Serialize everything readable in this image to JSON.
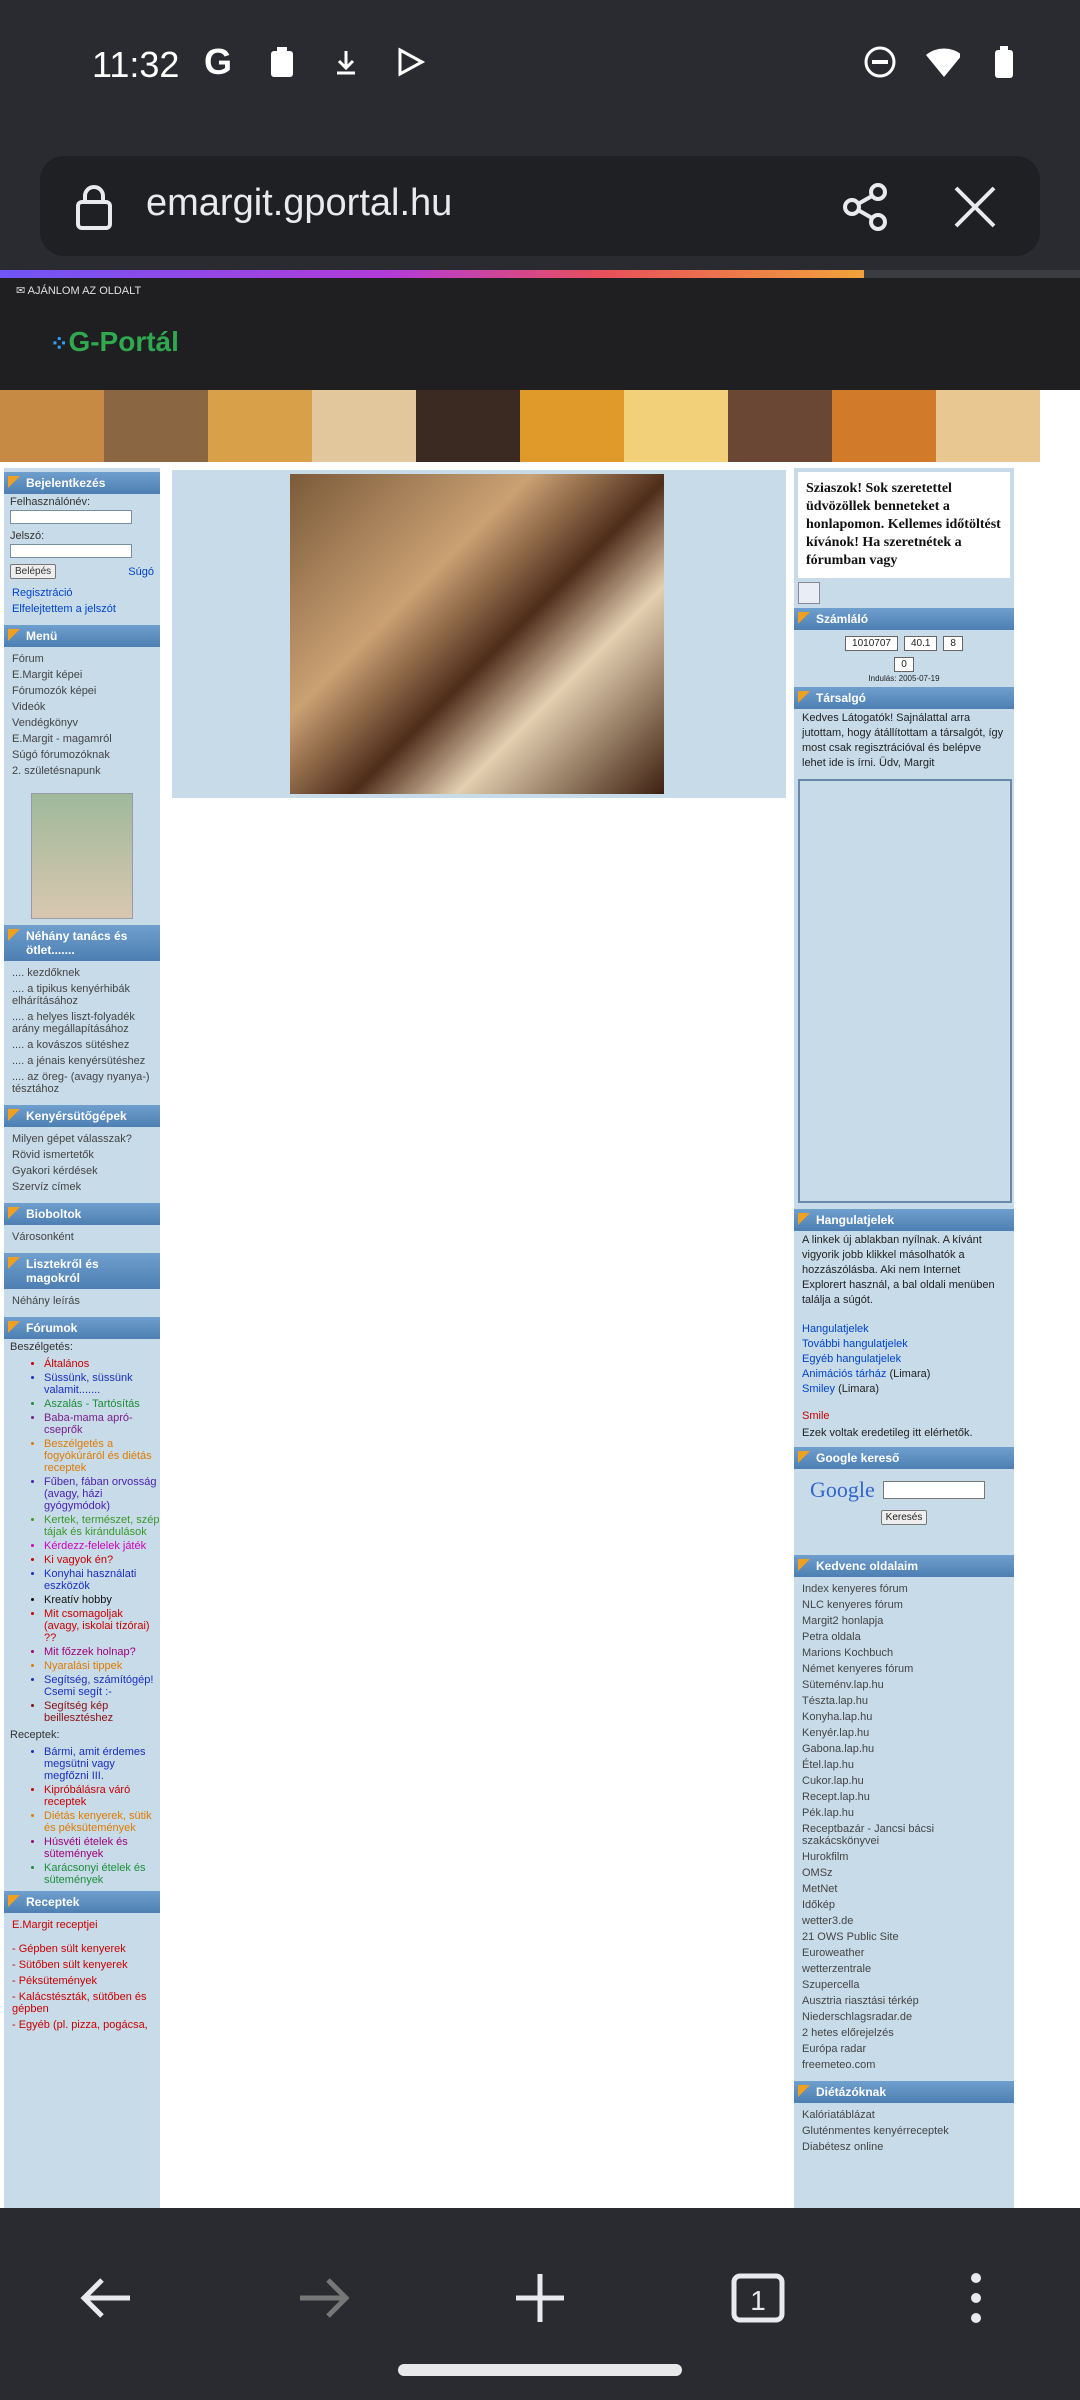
{
  "status_bar": {
    "time": "11:32"
  },
  "browser": {
    "url": "emargit.gportal.hu",
    "progress": 0.8
  },
  "site": {
    "recommend": "AJÁNLOM AZ OLDALT",
    "logo": "G-Portál",
    "login": {
      "title": "Bejelentkezés",
      "user_label": "Felhasználónév:",
      "pass_label": "Jelszó:",
      "login_button": "Belépés",
      "help": "Súgó",
      "register": "Regisztráció",
      "forgot": "Elfelejtettem a jelszót"
    },
    "menu": {
      "title": "Menü",
      "items": [
        "Fórum",
        "E.Margit képei",
        "Fórumozók képei",
        "Videók",
        "Vendégkönyv",
        "E.Margit - magamról",
        "Súgó fórumozóknak",
        "2. születésnapunk"
      ]
    },
    "tips": {
      "title": "Néhány tanács és ötlet.......",
      "items": [
        ".... kezdőknek",
        ".... a tipikus kenyérhibák elhárításához",
        ".... a helyes liszt-folyadék arány megállapításához",
        ".... a kovászos sütéshez",
        ".... a jénais kenyérsütéshez",
        ".... az öreg- (avagy nyanya-) tésztához"
      ]
    },
    "machines": {
      "title": "Kenyérsütőgépek",
      "items": [
        "Milyen gépet válasszak?",
        "Rövid ismertetők",
        "Gyakori kérdések",
        "Szervíz címek"
      ]
    },
    "bio": {
      "title": "Bioboltok",
      "items": [
        "Városonként"
      ]
    },
    "flour": {
      "title": "Lisztekről és magokról",
      "items": [
        "Néhány leírás"
      ]
    },
    "forums": {
      "title": "Fórumok",
      "conv_label": "Beszélgetés:",
      "conv": [
        {
          "text": "Általános",
          "color": "#cc0000"
        },
        {
          "text": "Süssünk, süssünk valamit.......",
          "color": "#1a2fbf"
        },
        {
          "text": "Aszalás - Tartósítás",
          "color": "#1e8f3a"
        },
        {
          "text": "Baba-mama apró-cseprők",
          "color": "#7a1f8a"
        },
        {
          "text": "Beszélgetés a fogyókúráról és diétás receptek",
          "color": "#e07b00"
        },
        {
          "text": "Fűben, fában orvosság (avagy, házi gyógymódok)",
          "color": "#4a1fb0"
        },
        {
          "text": "Kertek, természet, szép tájak és kirándulások",
          "color": "#3a9a2a"
        },
        {
          "text": "Kérdezz-felelek játék",
          "color": "#d000c0"
        },
        {
          "text": "Ki vagyok én?",
          "color": "#cc0000"
        },
        {
          "text": "Konyhai használati eszközök",
          "color": "#1a2fbf"
        },
        {
          "text": "Kreatív hobby",
          "color": "#111111"
        },
        {
          "text": "Mit csomagoljak (avagy, iskolai tízórai) ??",
          "color": "#cc0000"
        },
        {
          "text": "Mit főzzek holnap?",
          "color": "#a0007a"
        },
        {
          "text": "Nyaralási tippek",
          "color": "#e07b00"
        },
        {
          "text": "Segítség, számítógép! Csemi segít :-",
          "color": "#1a2fbf"
        },
        {
          "text": "Segítség kép beillesztéshez",
          "color": "#8a0f0f"
        }
      ],
      "recipes_label": "Receptek:",
      "recipes": [
        {
          "text": "Bármi, amit érdemes megsütni vagy megfőzni III.",
          "color": "#1a2fbf"
        },
        {
          "text": "Kipróbálásra váró receptek",
          "color": "#cc0000"
        },
        {
          "text": "Diétás kenyerek, sütik és péksütemények",
          "color": "#e07b00"
        },
        {
          "text": "Húsvéti ételek és sütemények",
          "color": "#a0007a"
        },
        {
          "text": "Karácsonyi ételek és sütemények",
          "color": "#1e8f3a"
        }
      ]
    },
    "receptek": {
      "title": "Receptek",
      "first": "E.Margit receptjei",
      "items": [
        "- Gépben sült kenyerek",
        "- Sütőben sült kenyerek",
        "- Péksütemények",
        "- Kalácstészták, sütőben és gépben",
        "- Egyéb (pl. pizza, pogácsa,"
      ]
    },
    "right": {
      "welcome": "Sziaszok! Sok szeretettel üdvözöllek benneteket a honlapomon. Kellemes időtöltést kívánok! Ha szeretnétek a fórumban vagy",
      "counter_title": "Számláló",
      "counter": [
        "1010707",
        "40.1",
        "8",
        "0"
      ],
      "since": "Indulás: 2005-07-19",
      "chat_title": "Társalgó",
      "chat_text": "Kedves Látogatók! Sajnálattal arra jutottam, hogy átállítottam a társalgót, így most csak regisztrációval és belépve lehet ide is írni. Üdv, Margit",
      "mood_title": "Hangulatjelek",
      "mood_text": "A linkek új ablakban nyílnak. A kívánt vigyorik jobb klikkel másolhatók a hozzászólásba. Aki nem Internet Explorert használ, a bal oldali menüben találja a súgót.",
      "mood_links": [
        "Hangulatjelek",
        "További hangulatjelek",
        "Egyéb hangulatjelek"
      ],
      "mood_anim": "Animációs tárház",
      "mood_anim_suffix": "(Limara)",
      "mood_smiley": "Smiley",
      "mood_smiley_suffix": "(Limara)",
      "smile": "Smile",
      "smile_note": "Ezek voltak eredetileg itt elérhetők.",
      "google_title": "Google kereső",
      "google_word": "Google",
      "search_button": "Keresés",
      "fav_title": "Kedvenc oldalaim",
      "favorites": [
        "Index kenyeres fórum",
        "NLC kenyeres fórum",
        "Margit2 honlapja",
        "Petra oldala",
        "Marions Kochbuch",
        "Német kenyeres fórum",
        "Süteménv.lap.hu",
        "Tészta.lap.hu",
        "Konyha.lap.hu",
        "Kenyér.lap.hu",
        "Gabona.lap.hu",
        "Étel.lap.hu",
        "Cukor.lap.hu",
        "Recept.lap.hu",
        "Pék.lap.hu",
        "Receptbazár - Jancsi bácsi szakácskönyvei",
        "Hurokfilm",
        "OMSz",
        "MetNet",
        "Időkép",
        "wetter3.de",
        "21 OWS Public Site",
        "Euroweather",
        "wetterzentrale",
        "Szupercella",
        "Ausztria riasztási térkép",
        "Niederschlagsradar.de",
        "2 hetes előrejelzés",
        "Európa radar",
        "freemeteo.com"
      ],
      "diet_title": "Diétázóknak",
      "diet_items": [
        "Kalóriatáblázat",
        "Gluténmentes kenyérreceptek",
        "Diabétesz online"
      ]
    }
  },
  "nav": {
    "tab_count": "1"
  },
  "colors": {
    "accent": "#4d7fb3",
    "panel_bg": "#c7dbe9",
    "chrome": "#2a2b30"
  }
}
